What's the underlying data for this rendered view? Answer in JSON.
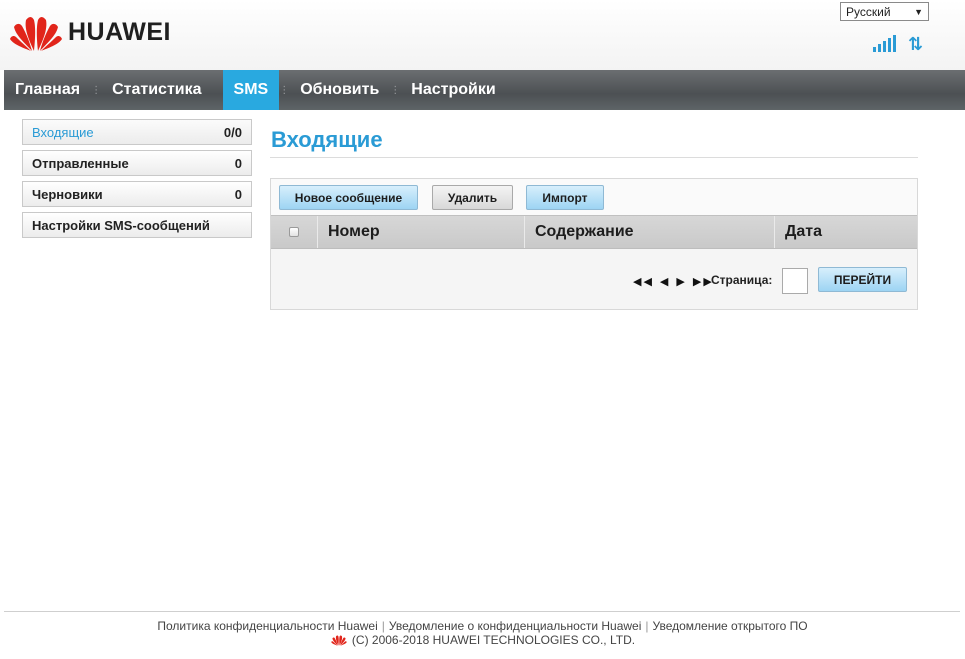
{
  "header": {
    "brand": "HUAWEI",
    "language": "Русский"
  },
  "nav": {
    "items": [
      {
        "label": "Главная"
      },
      {
        "label": "Статистика"
      },
      {
        "label": "SMS"
      },
      {
        "label": "Обновить"
      },
      {
        "label": "Настройки"
      }
    ],
    "active": "SMS"
  },
  "sidebar": {
    "items": [
      {
        "label": "Входящие",
        "count": "0/0"
      },
      {
        "label": "Отправленные",
        "count": "0"
      },
      {
        "label": "Черновики",
        "count": "0"
      },
      {
        "label": "Настройки SMS-сообщений",
        "count": ""
      }
    ]
  },
  "main": {
    "title": "Входящие",
    "toolbar": {
      "new_message": "Новое сообщение",
      "delete": "Удалить",
      "import": "Импорт"
    },
    "table": {
      "columns": [
        "Номер",
        "Содержание",
        "Дата"
      ]
    },
    "pager": {
      "page_label": "Страница:",
      "page_value": "",
      "go": "ПЕРЕЙТИ"
    }
  },
  "footer": {
    "links": [
      "Политика конфиденциальности Huawei",
      "Уведомление о конфиденциальности Huawei",
      "Уведомление открытого ПО"
    ],
    "copyright": "(C) 2006-2018 HUAWEI TECHNOLOGIES CO., LTD."
  },
  "colors": {
    "accent": "#2a9bd5",
    "nav_active": "#29a9e0",
    "nav_bg": "#515558",
    "logo_red": "#e1251b"
  }
}
